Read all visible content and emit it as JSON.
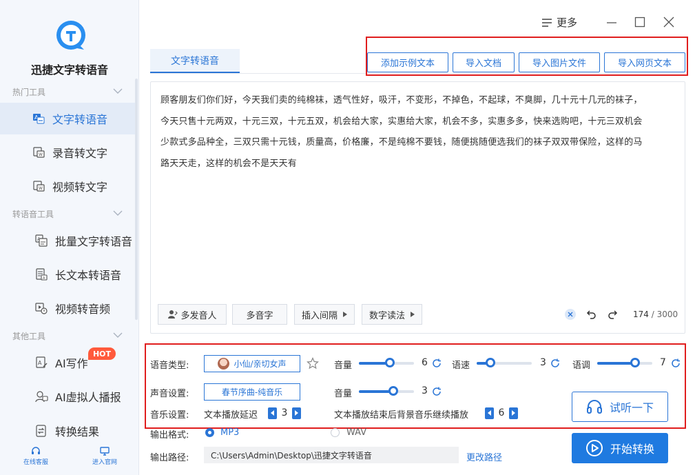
{
  "app": {
    "title": "迅捷文字转语音"
  },
  "sidebar": {
    "groups": [
      {
        "title": "热门工具"
      },
      {
        "title": "转语音工具"
      },
      {
        "title": "其他工具"
      }
    ],
    "items": [
      {
        "label": "文字转语音",
        "active": true
      },
      {
        "label": "录音转文字"
      },
      {
        "label": "视频转文字"
      },
      {
        "label": "批量文字转语音"
      },
      {
        "label": "长文本转语音"
      },
      {
        "label": "视频转音频"
      },
      {
        "label": "AI写作",
        "badge": "HOT"
      },
      {
        "label": "AI虚拟人播报"
      },
      {
        "label": "转换结果"
      }
    ],
    "bottom_links": [
      {
        "label": "在线客服",
        "icon": "headset-icon"
      },
      {
        "label": "进入官网",
        "icon": "monitor-icon"
      }
    ]
  },
  "titlebar": {
    "more_label": "更多"
  },
  "tabs": [
    {
      "label": "文字转语音"
    }
  ],
  "actions": {
    "add_sample": "添加示例文本",
    "import_doc": "导入文档",
    "import_image": "导入图片文件",
    "import_web": "导入网页文本"
  },
  "editor": {
    "lines": [
      "顾客朋友们你们好，今天我们卖的纯棉袜，透气性好，吸汗，不变形，不掉色，不起球，不臭脚，几十元十几元的袜子，",
      "今天只售十元两双，十元三双，十元五双，机会给大家，实惠给大家，机会不多，实惠多多，快来选购吧，十元三双机会",
      "少款式多品种全，三双只需十元钱，质量高，价格廉，不是纯棉不要钱，随便挑随便选我们的袜子双双带保险，这样的马",
      "路天天走，这样的机会不是天天有"
    ],
    "tools": {
      "multi_speaker": "多发音人",
      "polyphone": "多音字",
      "insert_pause": "插入间隔",
      "number_reading": "数字读法"
    },
    "count": "174",
    "max": "/ 3000"
  },
  "settings": {
    "voice_type_label": "语音类型:",
    "voice_name": "小仙/亲切女声",
    "volume_label": "音量",
    "volume_value": "6",
    "speed_label": "语速",
    "speed_value": "3",
    "pitch_label": "语调",
    "pitch_value": "7",
    "sound_label": "声音设置:",
    "music_name": "春节序曲-纯音乐",
    "music_volume_label": "音量",
    "music_volume_value": "3",
    "music_setting_label": "音乐设置:",
    "delay_label": "文本播放延迟",
    "delay_value": "3",
    "continue_label": "文本播放结束后背景音乐继续播放",
    "continue_value": "6",
    "listen_label": "试听一下",
    "format_label": "输出格式:",
    "format_options": [
      "MP3",
      "WAV"
    ],
    "path_label": "输出路径:",
    "path_value": "C:\\Users\\Admin\\Desktop\\迅捷文字转语音",
    "change_path": "更改路径",
    "convert_label": "开始转换"
  },
  "colors": {
    "accent": "#2a75d6",
    "primary_button": "#1f7ae0",
    "highlight_box": "#e01d1d",
    "hot_badge": "#ff5a3c"
  }
}
